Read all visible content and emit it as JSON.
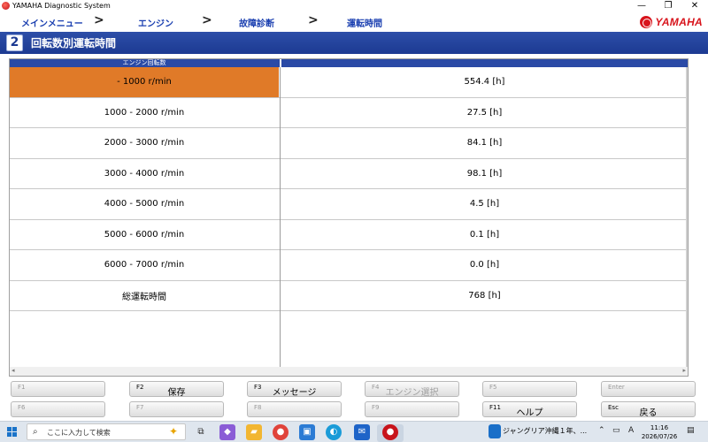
{
  "window": {
    "title": "YAMAHA Diagnostic System",
    "controls": [
      "—",
      "❐",
      "✕"
    ]
  },
  "breadcrumb": {
    "items": [
      "メインメニュー",
      "エンジン",
      "故障診断",
      "運転時間"
    ],
    "separator": ">"
  },
  "brand": {
    "logo_text": "YAMAHA",
    "color": "#d8141c"
  },
  "page": {
    "icon_glyph": "2",
    "title": "回転数別運転時間"
  },
  "table": {
    "column_header": "エンジン回転数",
    "rows": [
      {
        "range": " -  1000 r/min",
        "hours": "554.4 [h]",
        "selected": true
      },
      {
        "range": "1000  -  2000 r/min",
        "hours": "27.5 [h]"
      },
      {
        "range": "2000  -  3000 r/min",
        "hours": "84.1 [h]"
      },
      {
        "range": "3000  -  4000 r/min",
        "hours": "98.1 [h]"
      },
      {
        "range": "4000  -  5000 r/min",
        "hours": "4.5 [h]"
      },
      {
        "range": "5000  -  6000 r/min",
        "hours": "0.1 [h]"
      },
      {
        "range": "6000  -  7000 r/min",
        "hours": "0.0 [h]"
      },
      {
        "range": "総運転時間",
        "hours": "768 [h]"
      }
    ],
    "selected_color": "#e07a28",
    "header_color": "#2a4aa6"
  },
  "function_keys": {
    "row1": [
      {
        "key": "F1",
        "label": ""
      },
      {
        "key": "F2",
        "label": "保存"
      },
      {
        "key": "F3",
        "label": "メッセージ"
      },
      {
        "key": "F4",
        "label": "エンジン選択"
      },
      {
        "key": "F5",
        "label": ""
      },
      {
        "key": "Enter",
        "label": ""
      }
    ],
    "row2": [
      {
        "key": "F6",
        "label": ""
      },
      {
        "key": "F7",
        "label": ""
      },
      {
        "key": "F8",
        "label": ""
      },
      {
        "key": "F9",
        "label": ""
      },
      {
        "key": "F11",
        "label": "ヘルプ"
      },
      {
        "key": "Esc",
        "label": "戻る"
      }
    ]
  },
  "taskbar": {
    "search_placeholder": "ここに入力して検索",
    "notification": "ジャングリア沖縄１年、...",
    "ime": "A",
    "time": "11:16",
    "date": "2026/07/26"
  }
}
